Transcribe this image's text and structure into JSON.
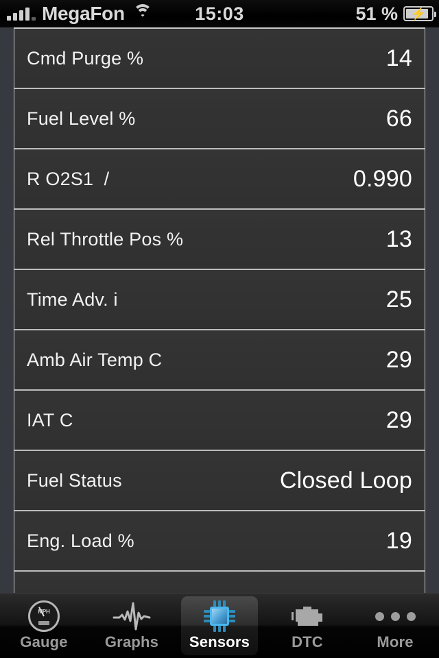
{
  "status_bar": {
    "carrier": "MegaFon",
    "signal_icon": "signal-bars-icon",
    "wifi_icon": "wifi-icon",
    "time": "15:03",
    "battery_percent": "51 %",
    "battery_icon": "battery-charging-icon",
    "battery_level": 51,
    "charging": true
  },
  "sensor_list": {
    "rows": [
      {
        "label": "Cmd Purge %",
        "value": "14"
      },
      {
        "label": "Fuel Level %",
        "value": "66"
      },
      {
        "label": "R O2S1  /",
        "value": "0.990"
      },
      {
        "label": "Rel Throttle Pos %",
        "value": "13"
      },
      {
        "label": "Time Adv. i",
        "value": "25"
      },
      {
        "label": "Amb Air Temp C",
        "value": "29"
      },
      {
        "label": "IAT C",
        "value": "29"
      },
      {
        "label": "Fuel Status",
        "value": "Closed Loop"
      },
      {
        "label": "Eng. Load %",
        "value": "19"
      },
      {
        "label": "",
        "value": ""
      }
    ]
  },
  "tab_bar": {
    "tabs": [
      {
        "label": "Gauge",
        "icon": "speedometer-icon",
        "active": false,
        "gauge_text": "MPH"
      },
      {
        "label": "Graphs",
        "icon": "waveform-icon",
        "active": false
      },
      {
        "label": "Sensors",
        "icon": "chip-icon",
        "active": true
      },
      {
        "label": "DTC",
        "icon": "engine-icon",
        "active": false
      },
      {
        "label": "More",
        "icon": "ellipsis-icon",
        "active": false
      }
    ]
  },
  "colors": {
    "row_background": "#313131",
    "separator": "#bdbdbd",
    "page_background": "#36393f",
    "accent_chip_blue": "#49b8f0",
    "text_primary": "#ffffff",
    "text_secondary": "#9a9a9a"
  }
}
